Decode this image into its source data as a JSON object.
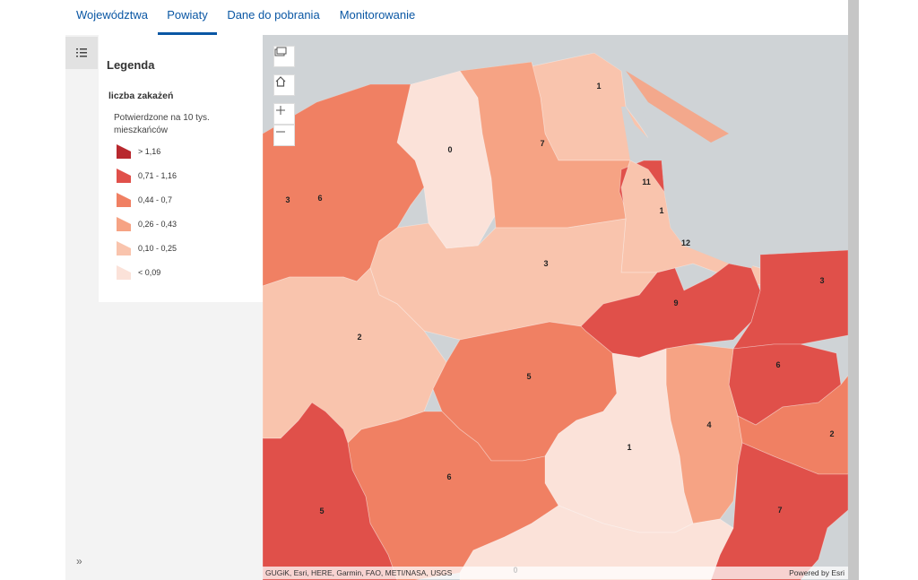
{
  "nav": {
    "tabs": [
      {
        "label": "Województwa",
        "active": false
      },
      {
        "label": "Powiaty",
        "active": true
      },
      {
        "label": "Dane do pobrania",
        "active": false
      },
      {
        "label": "Monitorowanie",
        "active": false
      }
    ]
  },
  "legend": {
    "title": "Legenda",
    "layer": "liczba zakażeń",
    "field": "Potwierdzone na 10 tys. mieszkańców",
    "items": [
      {
        "label": "> 1,16",
        "color": "#b8282e"
      },
      {
        "label": "0,71 - 1,16",
        "color": "#e0504a"
      },
      {
        "label": "0,44 - 0,7",
        "color": "#f08063"
      },
      {
        "label": "0,26 - 0,43",
        "color": "#f6a384"
      },
      {
        "label": "0,10 - 0,25",
        "color": "#f9c4ad"
      },
      {
        "label": "< 0,09",
        "color": "#fbe2d9"
      }
    ]
  },
  "map": {
    "attribution": "GUGiK, Esri, HERE, Garmin, FAO, METI/NASA, USGS",
    "powered_by": "Powered by Esri",
    "sea_color": "#cfd3d6",
    "regions": [
      {
        "label": "1",
        "color": "#f9c4ad"
      },
      {
        "label": "0",
        "color": "#fbe2d9"
      },
      {
        "label": "7",
        "color": "#f6a384"
      },
      {
        "label": "3",
        "color": "#f6a384"
      },
      {
        "label": "6",
        "color": "#f08063"
      },
      {
        "label": "11",
        "color": "#e0504a"
      },
      {
        "label": "1",
        "color": "#f9c4ad"
      },
      {
        "label": "12",
        "color": "#f9c4ad"
      },
      {
        "label": "3",
        "color": "#f9c4ad"
      },
      {
        "label": "3",
        "color": "#e0504a"
      },
      {
        "label": "9",
        "color": "#e0504a"
      },
      {
        "label": "2",
        "color": "#f9c4ad"
      },
      {
        "label": "5",
        "color": "#f08063"
      },
      {
        "label": "6",
        "color": "#e0504a"
      },
      {
        "label": "4",
        "color": "#f6a384"
      },
      {
        "label": "2",
        "color": "#f08063"
      },
      {
        "label": "1",
        "color": "#fbe2d9"
      },
      {
        "label": "6",
        "color": "#f08063"
      },
      {
        "label": "5",
        "color": "#e0504a"
      },
      {
        "label": "7",
        "color": "#e0504a"
      },
      {
        "label": "0",
        "color": "#fbe2d9"
      }
    ],
    "buttons": [
      "basemap-gallery-icon",
      "home-icon",
      "zoom-in-icon",
      "zoom-out-icon"
    ]
  }
}
